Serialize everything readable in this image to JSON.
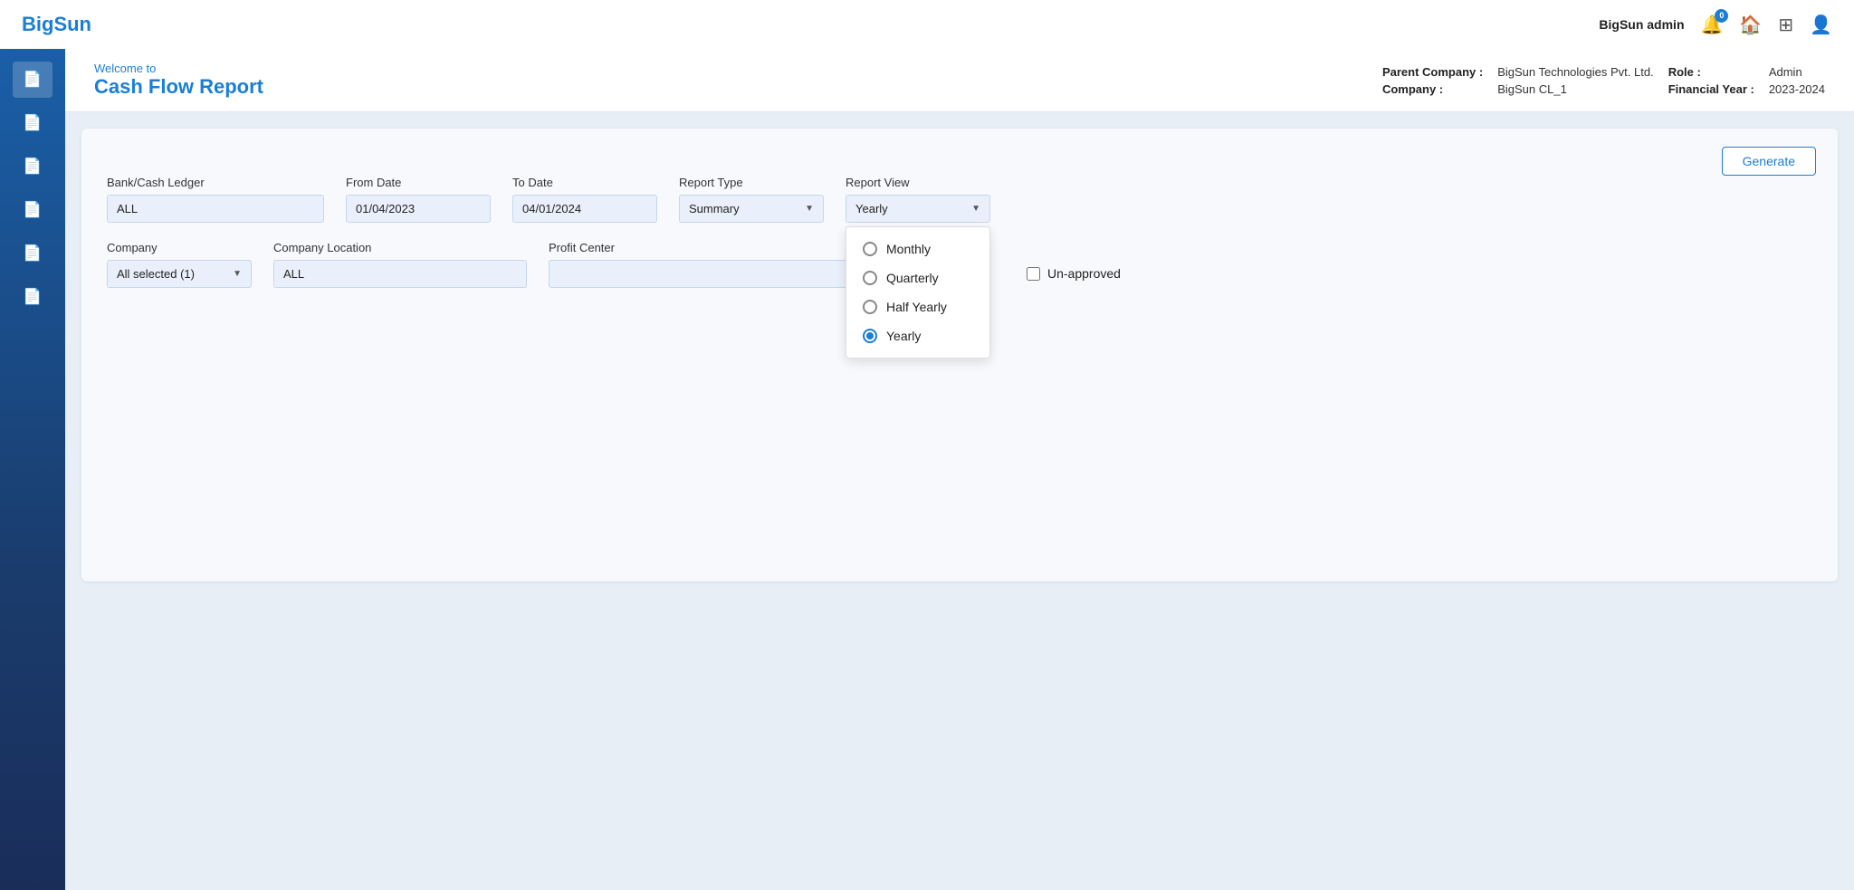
{
  "navbar": {
    "logo": "BigSun",
    "admin_label": "BigSun admin",
    "notification_count": "0",
    "icons": [
      "bell",
      "home",
      "grid",
      "user"
    ]
  },
  "sidebar": {
    "items": [
      {
        "id": "doc1",
        "icon": "📄"
      },
      {
        "id": "doc2",
        "icon": "📄"
      },
      {
        "id": "doc3",
        "icon": "📄"
      },
      {
        "id": "doc4",
        "icon": "📄"
      },
      {
        "id": "doc5",
        "icon": "📄"
      },
      {
        "id": "doc6",
        "icon": "📄"
      }
    ]
  },
  "page_header": {
    "welcome_text": "Welcome to",
    "page_title": "Cash Flow Report",
    "parent_company_label": "Parent Company :",
    "parent_company_value": "BigSun Technologies Pvt. Ltd.",
    "role_label": "Role :",
    "role_value": "Admin",
    "company_label": "Company :",
    "company_value": "BigSun CL_1",
    "financial_year_label": "Financial Year :",
    "financial_year_value": "2023-2024"
  },
  "toolbar": {
    "generate_label": "Generate"
  },
  "form": {
    "bank_cash_ledger_label": "Bank/Cash Ledger",
    "bank_cash_ledger_value": "ALL",
    "from_date_label": "From Date",
    "from_date_value": "01/04/2023",
    "to_date_label": "To Date",
    "to_date_value": "04/01/2024",
    "report_type_label": "Report Type",
    "report_type_value": "Summary",
    "report_view_label": "Report View",
    "report_view_value": "Yearly",
    "company_label": "Company",
    "company_value": "All selected (1)",
    "company_location_label": "Company Location",
    "company_location_value": "ALL",
    "profit_center_label": "Profit Center",
    "profit_center_value": "",
    "unapproved_label": "Un-approved"
  },
  "dropdown_menu": {
    "options": [
      {
        "label": "Monthly",
        "selected": false
      },
      {
        "label": "Quarterly",
        "selected": false
      },
      {
        "label": "Half Yearly",
        "selected": false
      },
      {
        "label": "Yearly",
        "selected": true
      }
    ]
  }
}
